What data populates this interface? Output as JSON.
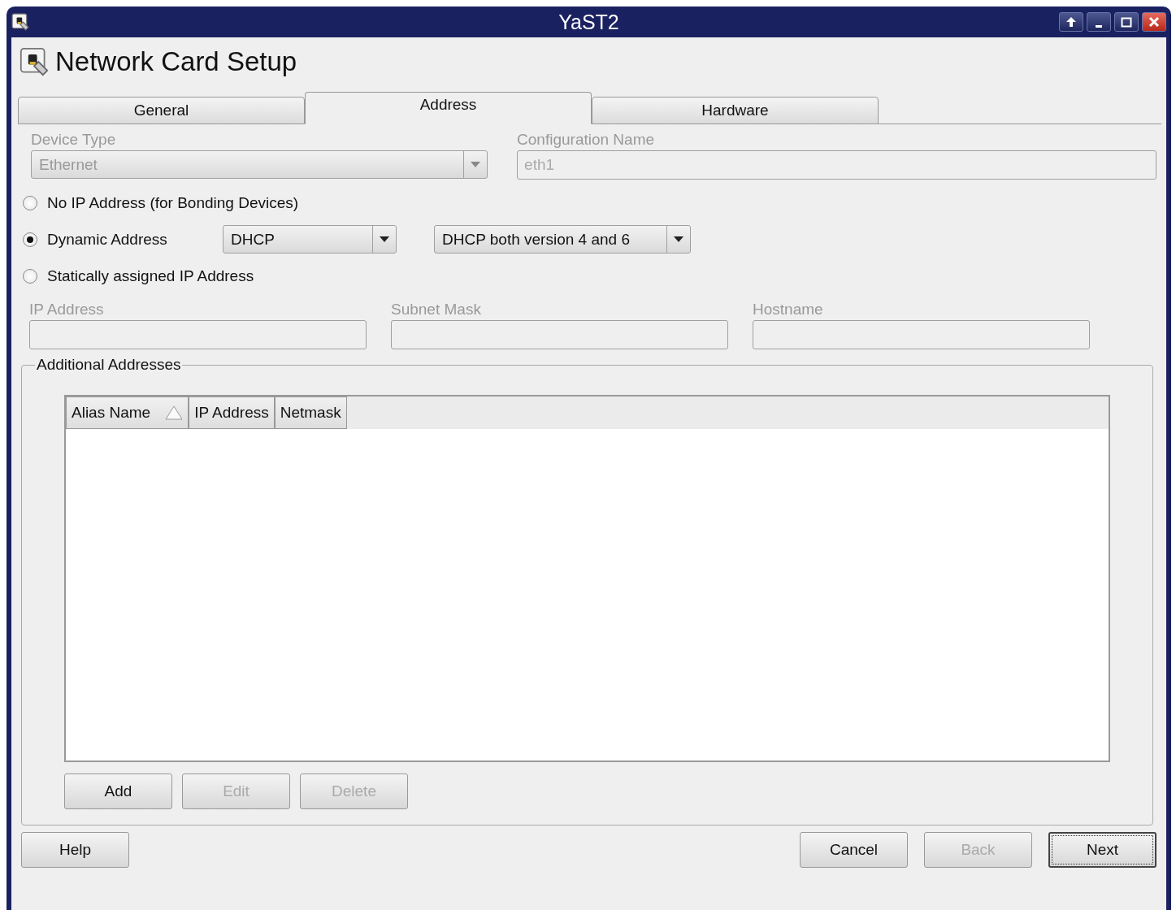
{
  "window": {
    "title": "YaST2"
  },
  "header": {
    "title": "Network Card Setup"
  },
  "tabs": [
    {
      "label": "General",
      "selected": false
    },
    {
      "label": "Address",
      "selected": true
    },
    {
      "label": "Hardware",
      "selected": false
    }
  ],
  "device_type": {
    "label": "Device Type",
    "value": "Ethernet",
    "disabled": true
  },
  "configuration_name": {
    "label": "Configuration Name",
    "value": "eth1",
    "disabled": true
  },
  "address_modes": [
    {
      "kind": "plain",
      "label": "No IP Address (for Bonding Devices)",
      "selected": false
    },
    {
      "kind": "dynamic",
      "label": "Dynamic Address",
      "selected": true,
      "options": [
        {
          "value": "DHCP"
        },
        {
          "value": "DHCP both version 4 and 6"
        }
      ]
    },
    {
      "kind": "plain",
      "label": "Statically assigned IP Address",
      "selected": false
    }
  ],
  "static_fields": [
    {
      "label": "IP Address",
      "disabled": true
    },
    {
      "label": "Subnet Mask",
      "disabled": true
    },
    {
      "label": "Hostname",
      "disabled": true
    }
  ],
  "additional_addresses": {
    "title": "Additional Addresses",
    "columns": [
      {
        "label": "Alias Name",
        "sorted": true
      },
      {
        "label": "IP Address",
        "sorted": false
      },
      {
        "label": "Netmask",
        "sorted": false
      }
    ],
    "buttons": [
      {
        "label": "Add",
        "disabled": false
      },
      {
        "label": "Edit",
        "disabled": true
      },
      {
        "label": "Delete",
        "disabled": true
      }
    ]
  },
  "footer": {
    "left": [
      {
        "label": "Help",
        "disabled": false,
        "default": false
      }
    ],
    "right": [
      {
        "label": "Cancel",
        "disabled": false,
        "default": false
      },
      {
        "label": "Back",
        "disabled": true,
        "default": false
      },
      {
        "label": "Next",
        "disabled": false,
        "default": true
      }
    ]
  }
}
